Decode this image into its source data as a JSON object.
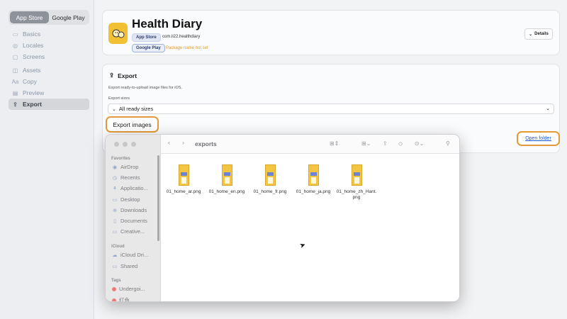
{
  "store_tabs": [
    "App Store",
    "Google Play"
  ],
  "nav": [
    {
      "label": "Basics",
      "icon": "folder-icon"
    },
    {
      "label": "Locales",
      "icon": "globe-icon"
    },
    {
      "label": "Screens",
      "icon": "screens-icon"
    },
    {
      "label": "Assets",
      "icon": "assets-icon"
    },
    {
      "label": "Copy",
      "icon": "text-icon"
    },
    {
      "label": "Preview",
      "icon": "preview-icon"
    },
    {
      "label": "Export",
      "icon": "export-icon"
    }
  ],
  "app": {
    "name": "Health Diary",
    "appstore_badge": "App Store",
    "bundle_id": "com.li22.healthdiary",
    "gplay_badge": "Google Play",
    "package_status": "Package name not set",
    "details_label": "Details"
  },
  "export": {
    "title": "Export",
    "description": "Export ready-to-upload image files for iOS.",
    "sizes_label": "Export sizes",
    "sizes_value": "All ready sizes",
    "export_button": "Export images",
    "open_folder": "Open folder"
  },
  "finder": {
    "title": "exports",
    "sections": {
      "favorites": "Favorites",
      "icloud": "iCloud",
      "tags": "Tags"
    },
    "favorites": [
      "AirDrop",
      "Recents",
      "Applicatio...",
      "Desktop",
      "Downloads",
      "Documents",
      "Creative..."
    ],
    "icloud": [
      "iCloud Dri...",
      "Shared"
    ],
    "tags": [
      "Undergoi...",
      "红色"
    ],
    "files": [
      "01_home_ar.png",
      "01_home_en.png",
      "01_home_fr.png",
      "01_home_ja.png",
      "01_home_zh_Hant.png"
    ]
  },
  "colors": {
    "highlight": "#e49a3a",
    "link": "#1a5bd6",
    "app_icon": "#f2c033",
    "tag_red": "#f07a7a"
  }
}
